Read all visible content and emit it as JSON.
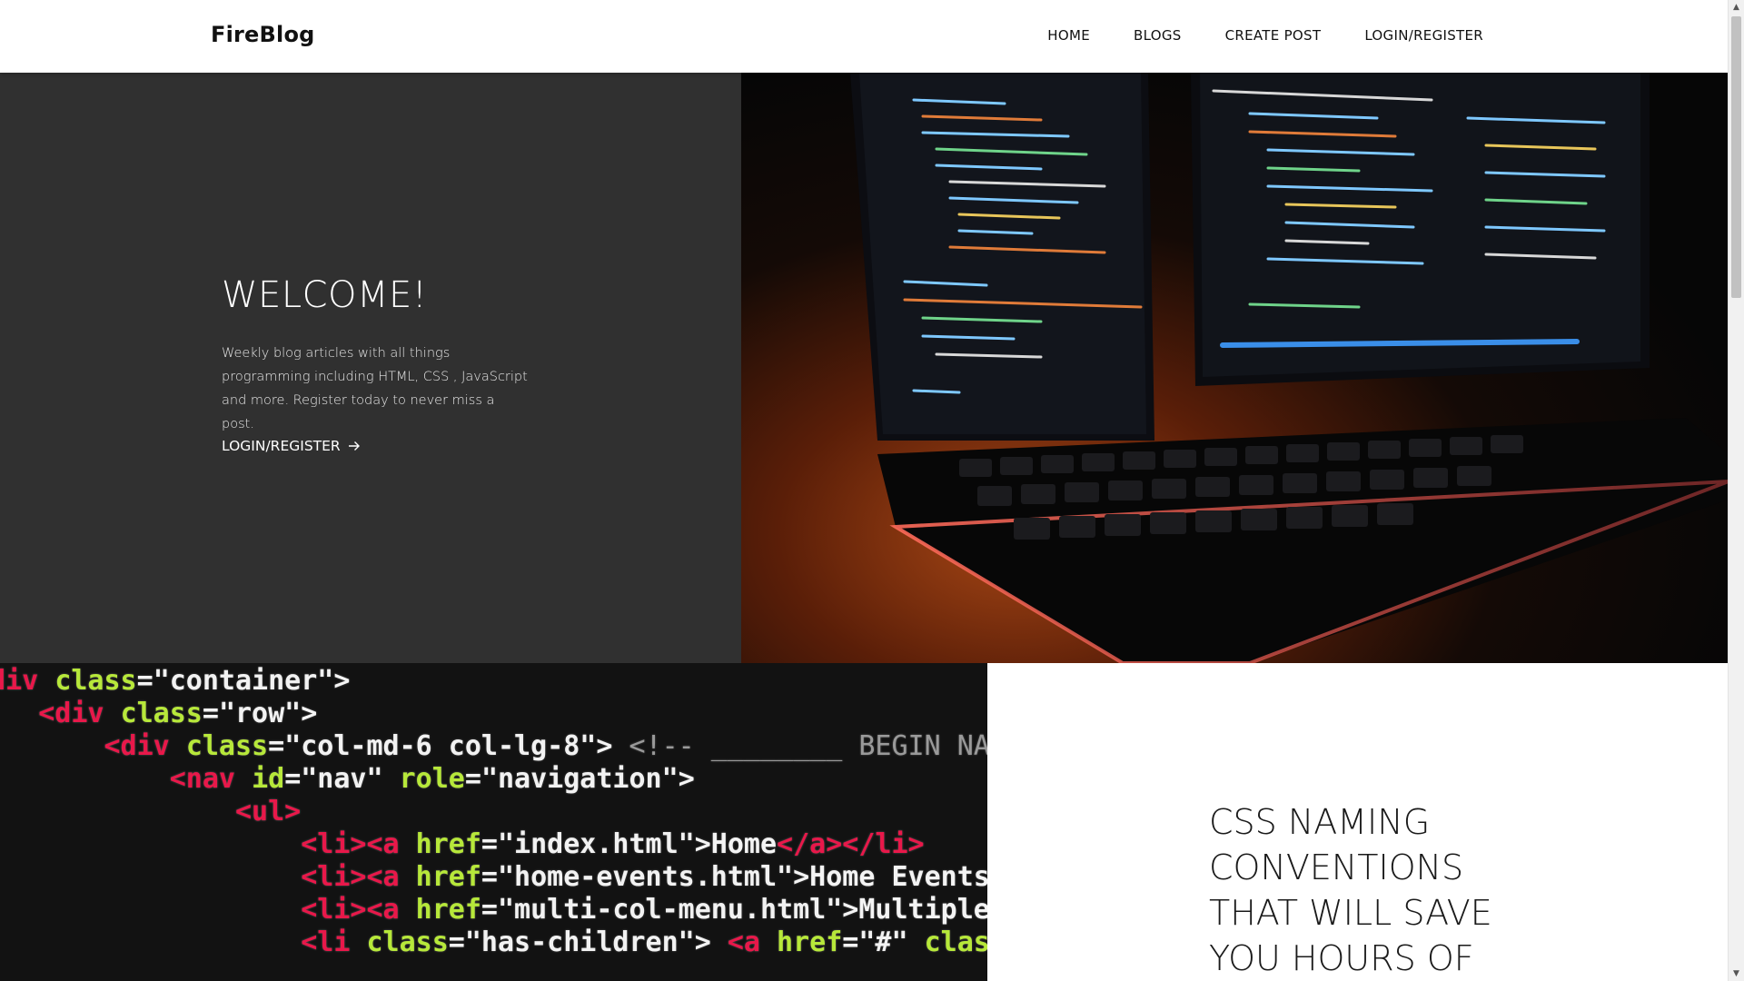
{
  "header": {
    "logo": "FireBlog",
    "nav": [
      {
        "label": "HOME"
      },
      {
        "label": "BLOGS"
      },
      {
        "label": "CREATE POST"
      },
      {
        "label": "LOGIN/REGISTER"
      }
    ]
  },
  "hero": {
    "title": "WELCOME!",
    "description": "Weekly blog articles with all things programming including HTML, CSS , JavaScript and more. Register today to never miss a post.",
    "link_label": "LOGIN/REGISTER",
    "link_icon": "arrow-right-icon"
  },
  "post": {
    "title": "CSS NAMING CONVENTIONS THAT WILL SAVE YOU HOURS OF"
  },
  "colors": {
    "hero_bg": "#303030",
    "accent_orange": "#a84715"
  }
}
